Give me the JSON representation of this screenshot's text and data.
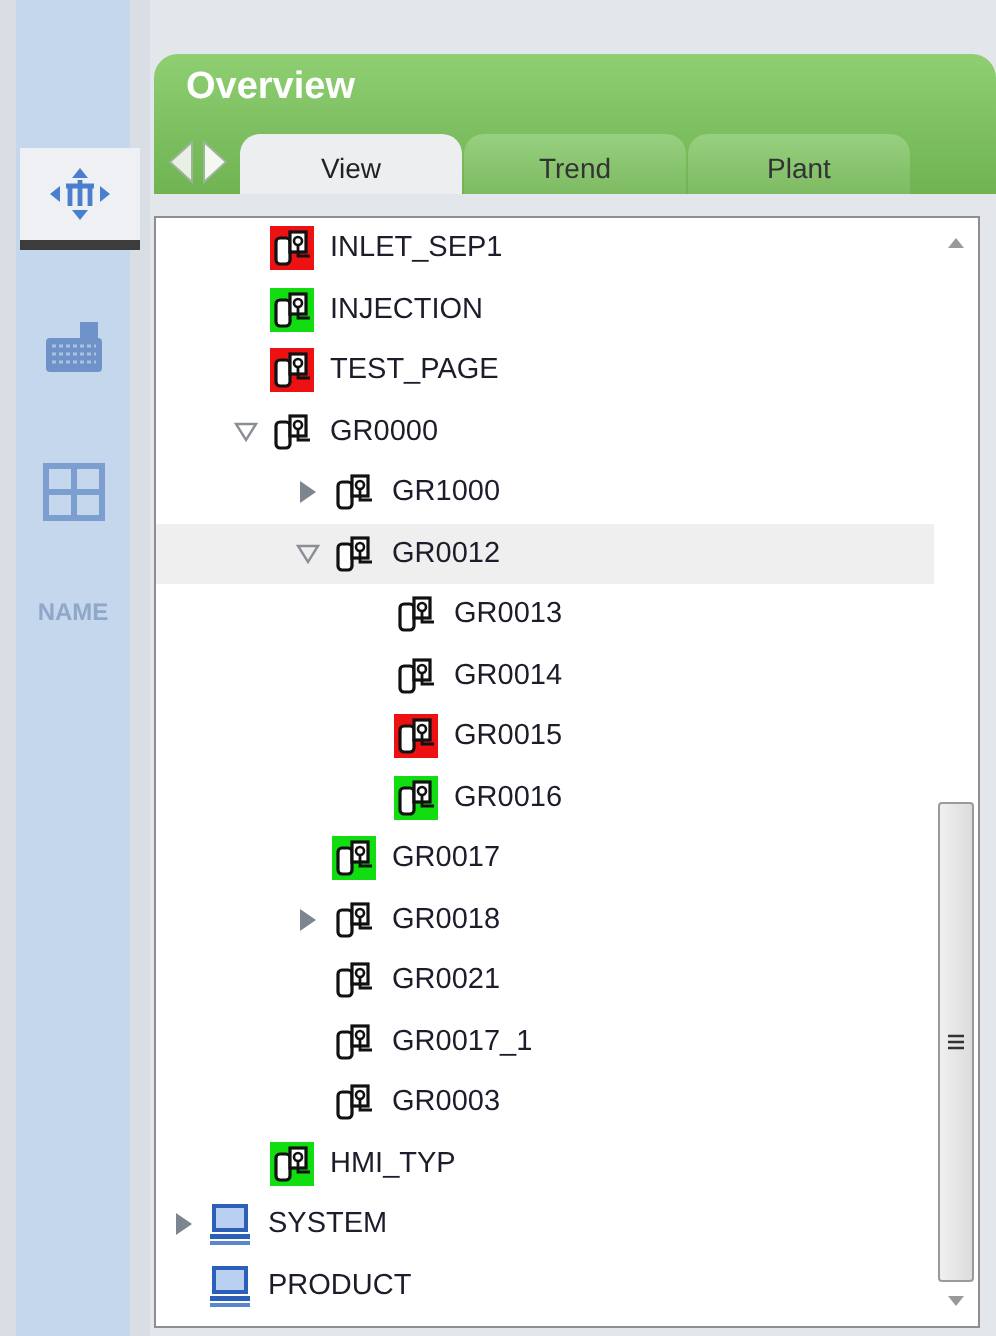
{
  "sidebar": {
    "items": [
      {
        "kind": "move",
        "selected": true
      },
      {
        "kind": "keyboard",
        "selected": false
      },
      {
        "kind": "grid",
        "selected": false
      }
    ],
    "label": "NAME"
  },
  "panel": {
    "title": "Overview",
    "tabs": [
      {
        "label": "View",
        "selected": true
      },
      {
        "label": "Trend",
        "selected": false
      },
      {
        "label": "Plant",
        "selected": false
      }
    ]
  },
  "tree": {
    "scrolled_children": [
      {
        "label": "INLET_SEP1",
        "kind": "device",
        "color": "#ee1111",
        "selected": false
      },
      {
        "label": "INJECTION",
        "kind": "device",
        "color": "#11dd11",
        "selected": false
      },
      {
        "label": "TEST_PAGE",
        "kind": "device",
        "color": "#ee1111",
        "selected": false
      },
      {
        "label": "GR0000",
        "kind": "device",
        "expanded": true,
        "selected": false,
        "children": [
          {
            "label": "GR1000",
            "kind": "device",
            "expanded": false,
            "selected": false
          },
          {
            "label": "GR0012",
            "kind": "device",
            "expanded": true,
            "selected": true,
            "children": [
              {
                "label": "GR0013",
                "kind": "device",
                "selected": false
              },
              {
                "label": "GR0014",
                "kind": "device",
                "selected": false
              },
              {
                "label": "GR0015",
                "kind": "device",
                "color": "#ee1111",
                "selected": false
              },
              {
                "label": "GR0016",
                "kind": "device",
                "color": "#11dd11",
                "selected": false
              }
            ]
          },
          {
            "label": "GR0017",
            "kind": "device",
            "color": "#11dd11",
            "selected": false
          },
          {
            "label": "GR0018",
            "kind": "device",
            "expanded": false,
            "selected": false
          },
          {
            "label": "GR0021",
            "kind": "device",
            "selected": false
          },
          {
            "label": "GR0017_1",
            "kind": "device",
            "selected": false
          },
          {
            "label": "GR0003",
            "kind": "device",
            "selected": false
          }
        ]
      },
      {
        "label": "HMI_TYP",
        "kind": "device",
        "color": "#11dd11",
        "selected": false
      }
    ],
    "items": [
      {
        "label": "SYSTEM",
        "kind": "computer",
        "expanded": false,
        "selected": false
      },
      {
        "label": "PRODUCT",
        "kind": "computer",
        "selected": false
      }
    ]
  }
}
